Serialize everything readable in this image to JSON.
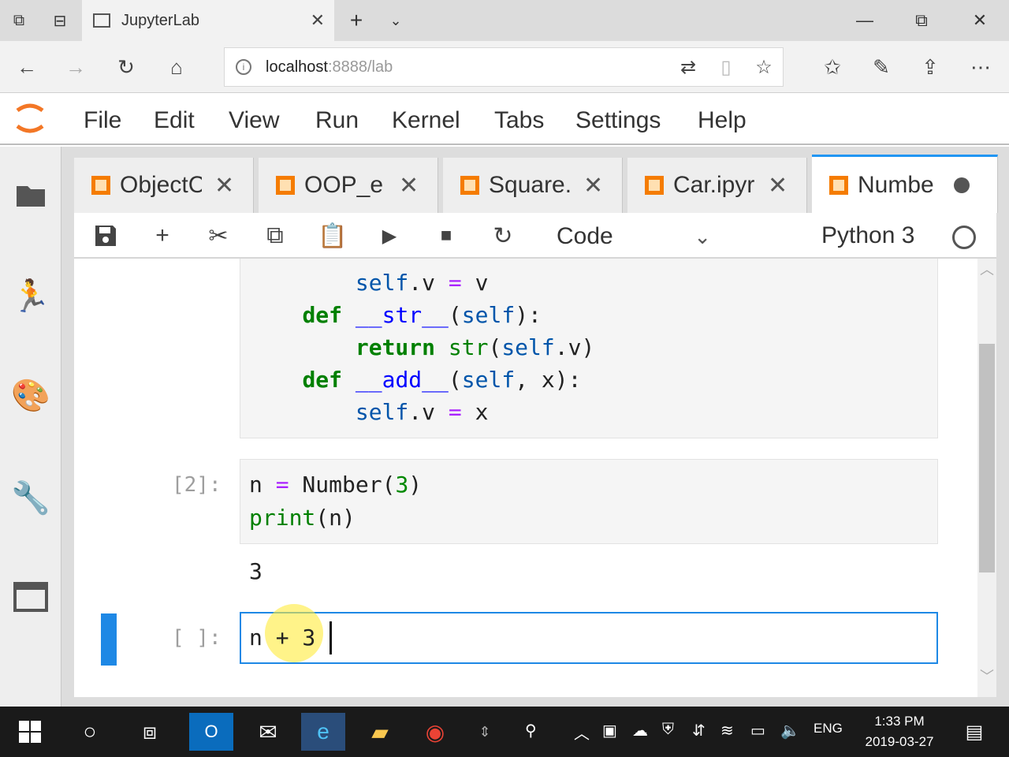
{
  "browser": {
    "tab_title": "JupyterLab",
    "new_tab_label": "+",
    "url_host": "localhost",
    "url_rest": ":8888/lab"
  },
  "menubar": {
    "items": [
      "File",
      "Edit",
      "View",
      "Run",
      "Kernel",
      "Tabs",
      "Settings",
      "Help"
    ]
  },
  "doc_tabs": [
    {
      "label": "ObjectC",
      "close": "✕"
    },
    {
      "label": "OOP_e",
      "close": "✕"
    },
    {
      "label": "Square.",
      "close": "✕"
    },
    {
      "label": "Car.ipyr",
      "close": "✕"
    },
    {
      "label": "Numbe",
      "unsaved": true
    }
  ],
  "toolbar": {
    "cell_type": "Code",
    "kernel": "Python 3"
  },
  "cells": {
    "class_cell_lines": [
      "        self.v = v",
      "    def __str__(self):",
      "        return str(self.v)",
      "    def __add__(self, x):",
      "        self.v = x"
    ],
    "cell2_prompt": "[2]:",
    "cell2_lines": [
      "n = Number(3)",
      "print(n)"
    ],
    "cell2_output": "3",
    "cell3_prompt": "[ ]:",
    "cell3_code": "n + 3"
  },
  "taskbar": {
    "language": "ENG",
    "time": "1:33 PM",
    "date": "2019-03-27"
  }
}
